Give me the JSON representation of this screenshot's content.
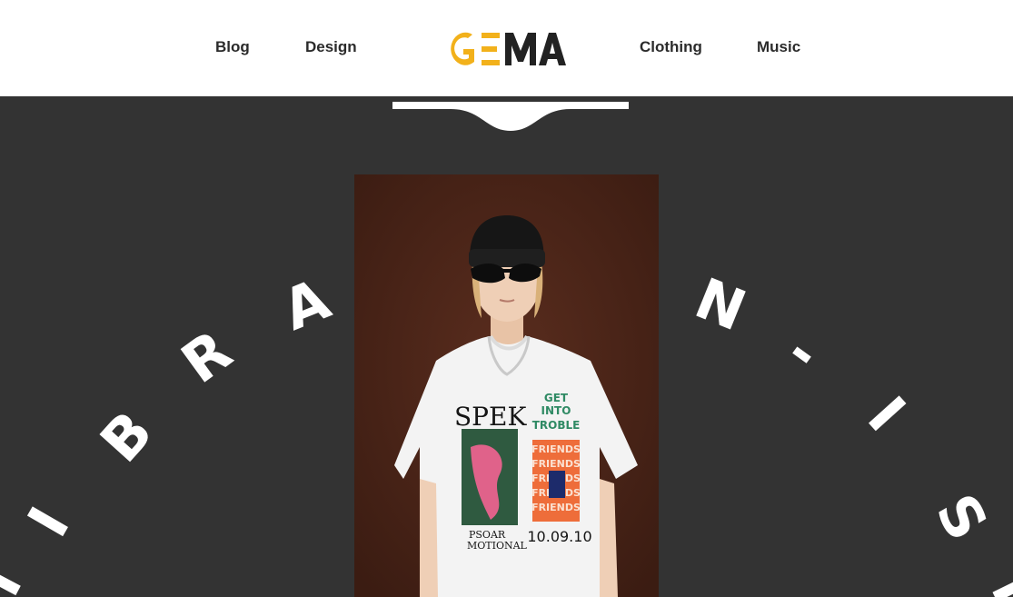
{
  "header": {
    "nav_left": [
      {
        "label": "Blog"
      },
      {
        "label": "Design"
      }
    ],
    "nav_right": [
      {
        "label": "Clothing"
      },
      {
        "label": "Music"
      }
    ],
    "logo": {
      "text": "GEMA",
      "accent_color": "#F2B11B",
      "text_color": "#222222"
    }
  },
  "hero": {
    "background_color": "#333333",
    "rotating_text": [
      "I",
      "B",
      "R",
      "A",
      "N",
      "-",
      "I",
      "S",
      "I"
    ],
    "photo": {
      "shirt": {
        "left_print_title": "SPEK",
        "left_print_caption": [
          "PSOAR",
          "MOTIONAL"
        ],
        "right_print_title": [
          "GET",
          "INTO",
          "TROBLE"
        ],
        "right_print_words": "FRIENDS",
        "right_print_date": "10.09.10"
      }
    }
  },
  "icons": {
    "logo": "gema-logo",
    "scroll_tab": "scroll-tab-icon"
  }
}
